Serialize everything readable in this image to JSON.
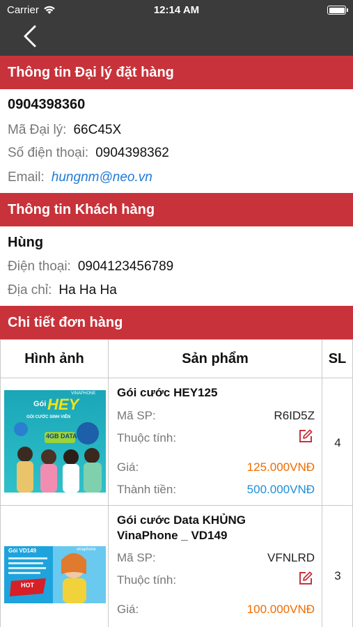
{
  "status_bar": {
    "carrier": "Carrier",
    "time": "12:14 AM"
  },
  "agent_section": {
    "title": "Thông tin Đại lý đặt hàng",
    "phone_main": "0904398360",
    "code_label": "Mã Đại lý:",
    "code_value": "66C45X",
    "phone_label": "Số điện thoại:",
    "phone_value": "0904398362",
    "email_label": "Email:",
    "email_value": "hungnm@neo.vn"
  },
  "customer_section": {
    "title": "Thông tin Khách hàng",
    "name": "Hùng",
    "phone_label": "Điện thoại:",
    "phone_value": "0904123456789",
    "address_label": "Địa chỉ:",
    "address_value": "Ha Ha Ha"
  },
  "order_section": {
    "title": "Chi tiết đơn hàng",
    "columns": [
      "Hình ảnh",
      "Sản phẩm",
      "SL"
    ],
    "items": [
      {
        "name": "Gói cước HEY125",
        "code_label": "Mã SP:",
        "code": "R6ID5Z",
        "attr_label": "Thuộc tính:",
        "price_label": "Giá:",
        "price": "125.000VNĐ",
        "total_label": "Thành tiền:",
        "total": "500.000VNĐ",
        "qty": "4",
        "banner": {
          "prefix": "Gói",
          "headline": "HEY",
          "sub": "GÓI CƯỚC SINH VIÊN",
          "badge": "4GB DATA",
          "brand": "VINAPHONE"
        }
      },
      {
        "name": "Gói cước Data KHỦNG VinaPhone _ VD149",
        "code_label": "Mã SP:",
        "code": "VFNLRD",
        "attr_label": "Thuộc tính:",
        "price_label": "Giá:",
        "price": "100.000VNĐ",
        "qty": "3",
        "banner": {
          "headline": "Gói VD149",
          "badge": "HOT",
          "brand": "vinaphone"
        }
      }
    ]
  },
  "colors": {
    "header_bar": "#3b3b3b",
    "section_red": "#c8323a",
    "link_blue": "#1f7bd6",
    "price_orange": "#ef6c00",
    "total_blue": "#1e8fd6"
  }
}
